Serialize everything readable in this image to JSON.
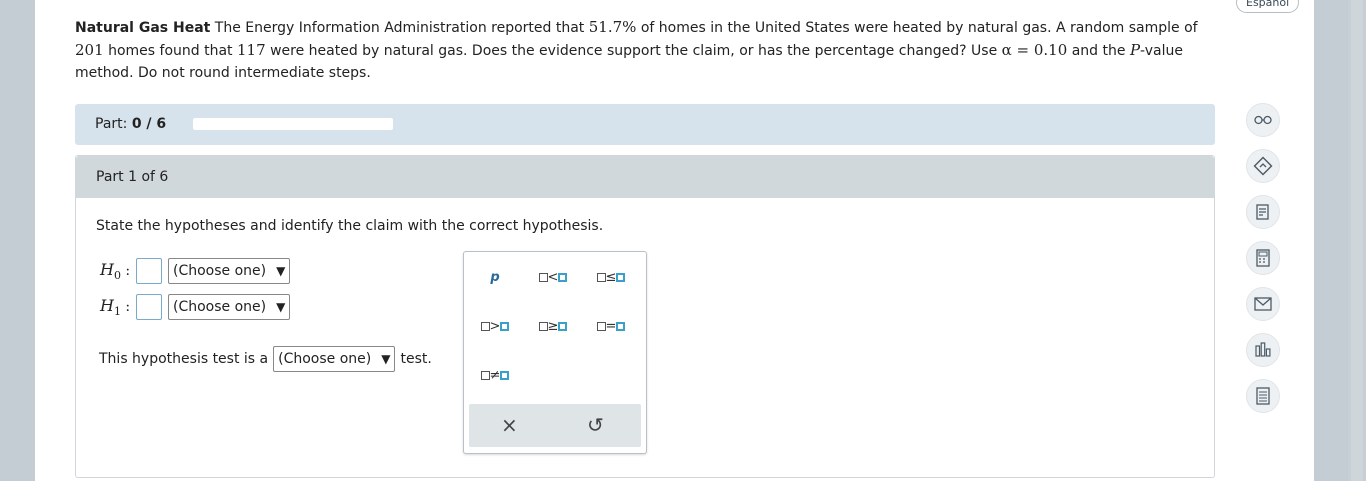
{
  "language_button": "Español",
  "problem": {
    "title": "Natural Gas Heat",
    "text_1": " The Energy Information Administration reported that ",
    "pct": "51.7%",
    "text_2": " of homes in the United States were heated by natural gas. A random sample of ",
    "n": "201",
    "text_3": " homes found that ",
    "x": "117",
    "text_4": " were heated by natural gas. Does the evidence support the claim, or has the percentage changed? Use ",
    "alpha": "α = 0.10",
    "text_5": " and the ",
    "p_letter": "P",
    "text_6": "-value method. Do not round intermediate steps."
  },
  "progress": {
    "label": "Part:",
    "value": "0 / 6",
    "fraction": 0
  },
  "part": {
    "header": "Part 1 of 6",
    "instruction": "State the hypotheses and identify the claim with the correct hypothesis.",
    "h0_label": "H",
    "h0_sub": "0",
    "h1_label": "H",
    "h1_sub": "1",
    "colon": ":",
    "select_default": "(Choose one)",
    "test_prefix": "This hypothesis test is a",
    "test_suffix": "test."
  },
  "palette": {
    "p_symbol": "p",
    "lt": "<",
    "le": "≤",
    "gt": ">",
    "ge": "≥",
    "eq": "=",
    "ne": "≠",
    "clear": "×",
    "undo": "↺"
  },
  "tools": [
    "glasses-icon",
    "hint-icon",
    "notes-icon",
    "calculator-icon",
    "mail-icon",
    "chart-icon",
    "data-icon"
  ]
}
